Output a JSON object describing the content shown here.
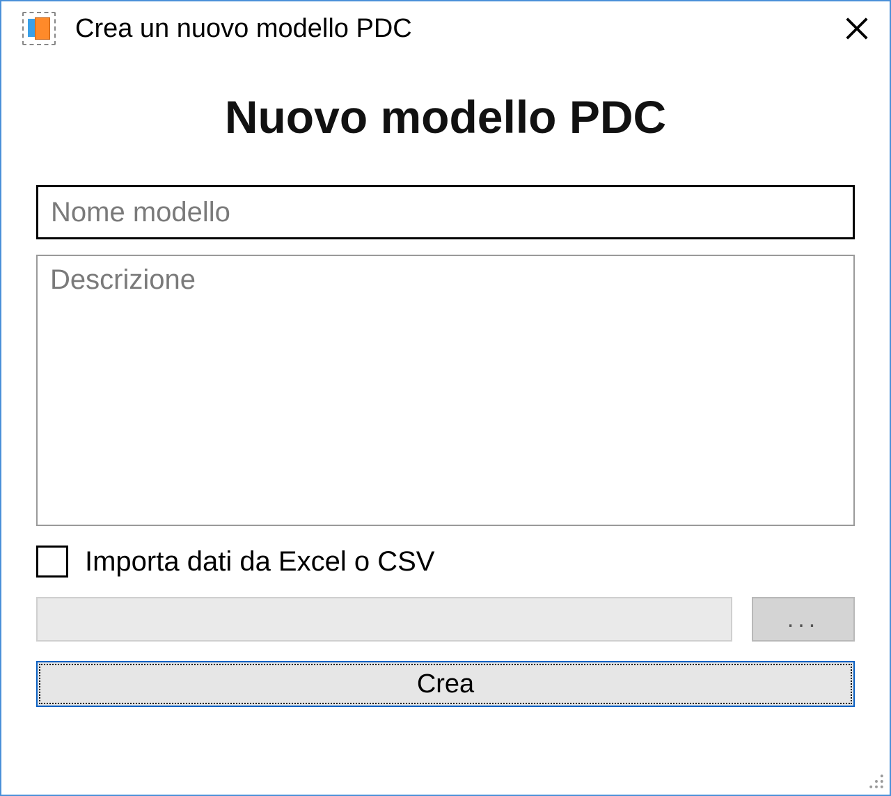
{
  "window": {
    "title": "Crea un nuovo modello PDC"
  },
  "main": {
    "heading": "Nuovo modello PDC",
    "model_name_placeholder": "Nome modello",
    "model_name_value": "",
    "description_placeholder": "Descrizione",
    "description_value": "",
    "import_checkbox_label": "Importa dati da Excel o CSV",
    "import_checkbox_checked": false,
    "filepath_value": "",
    "browse_label": "...",
    "create_label": "Crea"
  }
}
